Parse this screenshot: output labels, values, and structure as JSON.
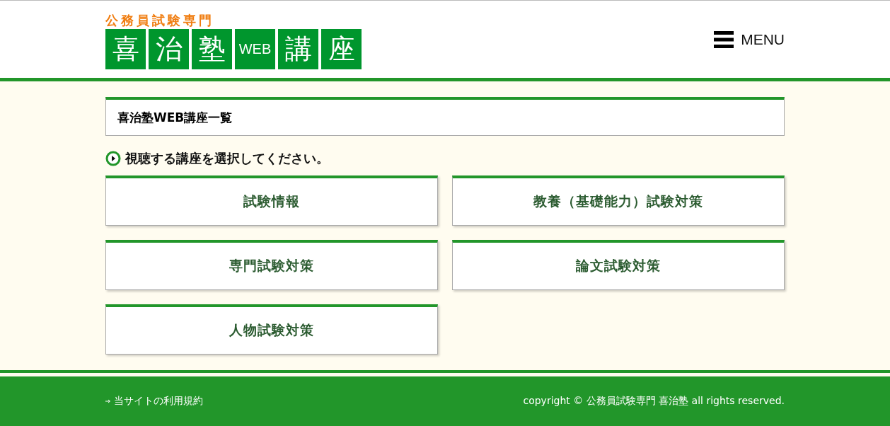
{
  "header": {
    "tagline": "公務員試験専門",
    "logo_tiles": [
      "喜",
      "治",
      "塾",
      "WEB",
      "講",
      "座"
    ],
    "menu_label": "MENU"
  },
  "page_title": "喜治塾WEB講座一覧",
  "instruction": "視聴する講座を選択してください。",
  "courses": [
    "試験情報",
    "教養（基礎能力）試験対策",
    "専門試験対策",
    "論文試験対策",
    "人物試験対策"
  ],
  "footer": {
    "terms_link": "当サイトの利用規約",
    "copyright": "copyright © 公務員試験専門 喜治塾 all rights reserved."
  }
}
